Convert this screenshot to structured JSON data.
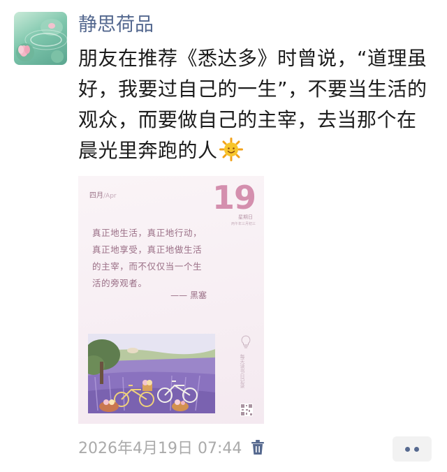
{
  "post": {
    "author_name": "静思荷品",
    "text": "朋友在推荐《悉达多》时曾说，“道理虽好，我要过自己的一生”，不要当生活的观众，而要做自己的主宰，去当那个在晨光里奔跑的人",
    "emoji": "sun-with-face",
    "timestamp": "2026年4月19日 07:44"
  },
  "card": {
    "month_cn": "四月",
    "month_en": "/Apr",
    "day": "19",
    "weekday": "星期日",
    "lunar": "丙午年三月初三",
    "quote": "真正地生活，真正地行动，真正地享受，真正地做生活的主宰，而不仅仅当一个生活的旁观者。",
    "quote_author": "—— 黑塞",
    "side_caption": "每天读书日记录"
  },
  "colors": {
    "nickname": "#54688f",
    "accent_pink": "#d48fae",
    "timestamp": "#aaaaaa"
  },
  "icons": {
    "delete": "trash-icon",
    "more": "more-dots-icon"
  }
}
